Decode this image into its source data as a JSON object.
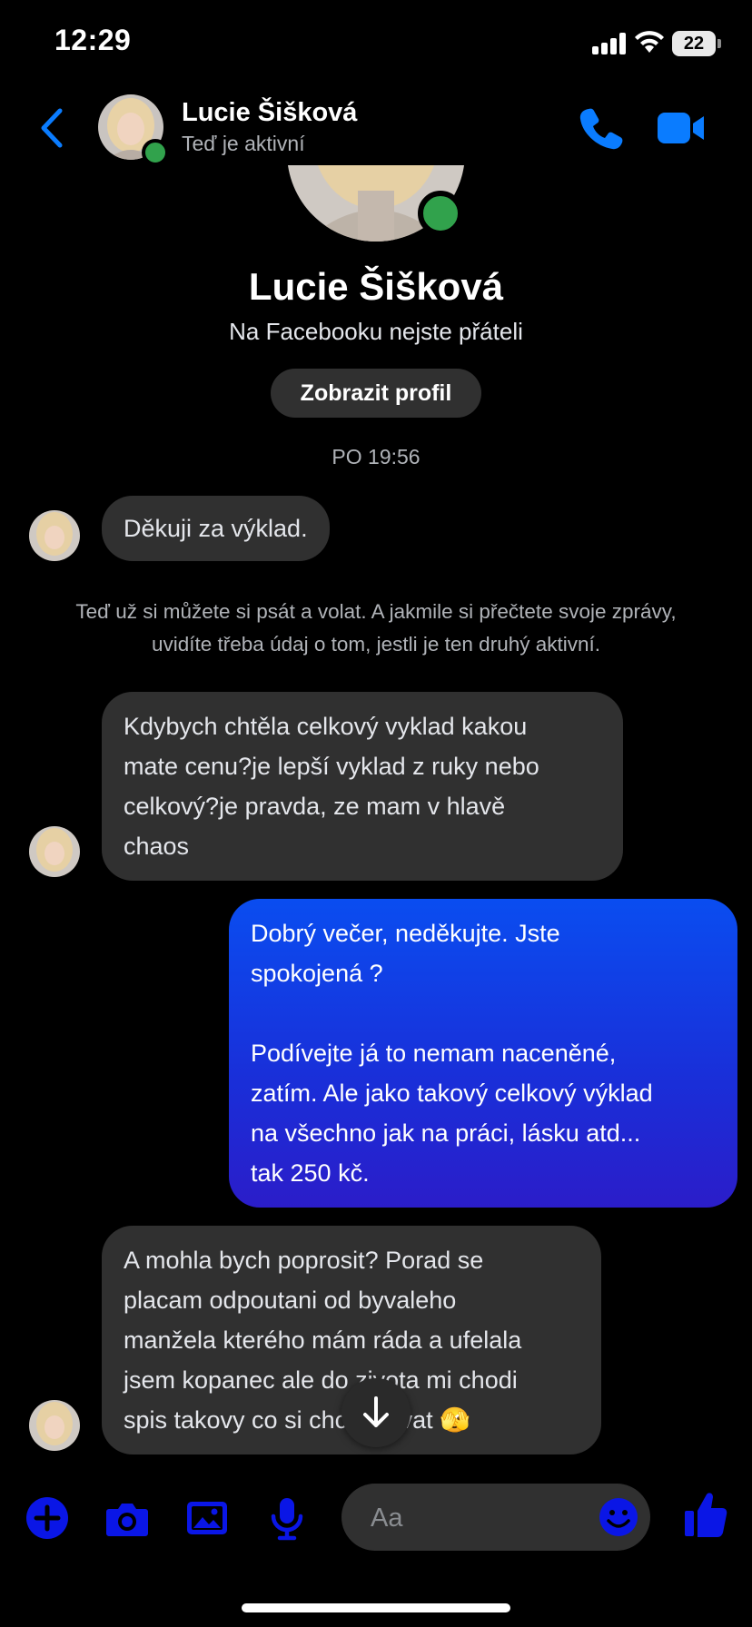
{
  "status_bar": {
    "time": "12:29",
    "battery": "22"
  },
  "header": {
    "name": "Lucie Šišková",
    "status": "Teď je aktivní"
  },
  "profile": {
    "name": "Lucie Šišková",
    "subtitle": "Na Facebooku nejste přáteli",
    "view_profile_label": "Zobrazit profil"
  },
  "thread": {
    "timestamp": "PO 19:56",
    "messages": [
      {
        "from": "them",
        "text": "Děkuji za výklad."
      },
      {
        "from": "system",
        "text": "Teď už si můžete si psát a volat. A jakmile si přečtete svoje zprávy, uvidíte třeba údaj o tom, jestli je ten druhý aktivní."
      },
      {
        "from": "them",
        "lines": [
          "Kdybych chtěla celkový vyklad kakou",
          "mate cenu?je lepší vyklad z ruky nebo",
          "celkový?je pravda, ze mam v hlavě",
          "chaos"
        ]
      },
      {
        "from": "me",
        "lines": [
          "Dobrý večer, neděkujte. Jste",
          "spokojená ?",
          "",
          "Podívejte já to nemam naceněné,",
          "zatím. Ale jako takový celkový výklad",
          "na všechno jak na práci, lásku atd...",
          "tak 250 kč."
        ]
      },
      {
        "from": "them",
        "lines": [
          "A mohla bych poprosit? Porad se",
          "placam odpoutani od byvaleho",
          "manžela kterého mám ráda a ufelala",
          "jsem kopanec ale do zivota mi chodi",
          "spis takovy co si chce užívat 🫣"
        ]
      }
    ]
  },
  "composer": {
    "placeholder": "Aa"
  },
  "colors": {
    "accent": "#0a7cff",
    "composer_icons": "#0a16e6",
    "online": "#31a24c"
  }
}
